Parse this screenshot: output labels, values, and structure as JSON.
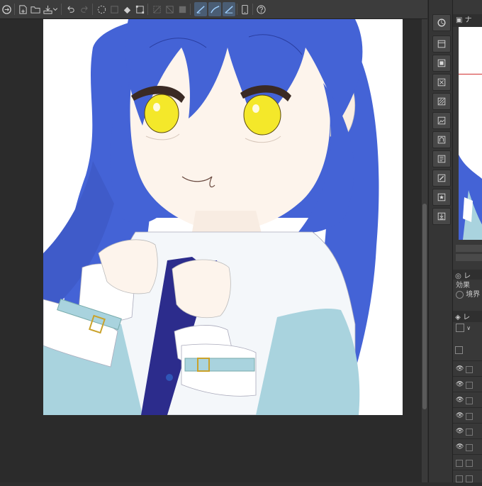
{
  "panels": {
    "effect_label": "効果",
    "border_label": "境界",
    "layer_tab_label": "レ",
    "navigator_tab_label": "ナ"
  },
  "colors": {
    "hair": "#4463d6",
    "eyes": "#f4e82a",
    "skin": "#fdf4ec",
    "shirt": "#a9d3de",
    "tie": "#2c2c8c",
    "accent_blue": "#4a5d74"
  }
}
